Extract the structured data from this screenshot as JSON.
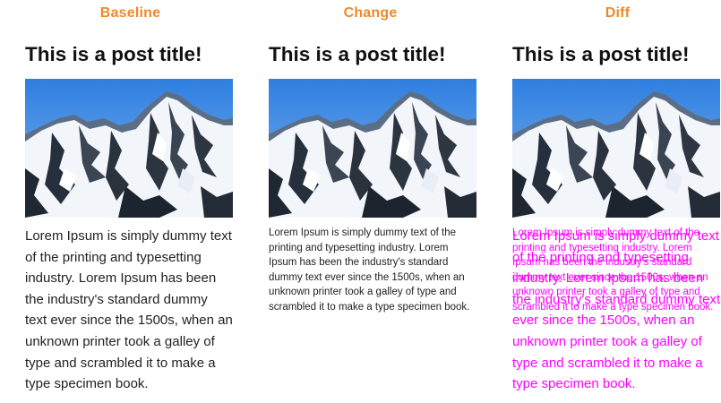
{
  "columns": {
    "baseline": {
      "label": "Baseline"
    },
    "change": {
      "label": "Change"
    },
    "diff": {
      "label": "Diff"
    }
  },
  "post": {
    "title": "This is a post title!",
    "body": "Lorem Ipsum is simply dummy text of the printing and typesetting industry. Lorem Ipsum has been the industry's standard dummy text ever since the 1500s, when an unknown printer took a galley of type and scrambled it to make a type specimen book."
  },
  "colors": {
    "label": "#ec8a2b",
    "diff_highlight": "#ff00ff",
    "text": "#222222"
  },
  "image": {
    "subject": "snowy-mountain-photo"
  }
}
